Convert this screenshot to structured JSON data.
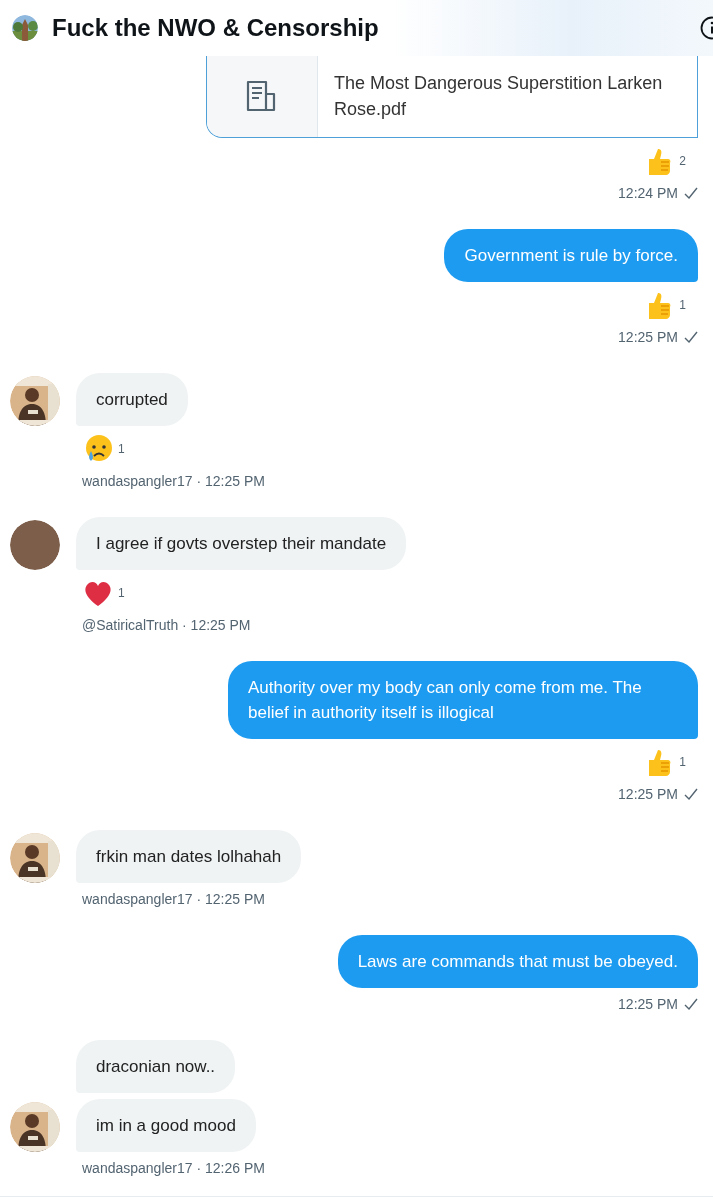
{
  "header": {
    "title": "Fuck the NWO & Censorship"
  },
  "messages": [
    {
      "kind": "attachment",
      "title": "The Most Dangerous Superstition Larken Rose.pdf",
      "reactions": [
        {
          "kind": "thumbs_up",
          "count": "2"
        }
      ],
      "time": "12:24 PM",
      "seen": true
    },
    {
      "kind": "sent",
      "bubbles": [
        "Government is rule by force."
      ],
      "reactions": [
        {
          "kind": "thumbs_up",
          "count": "1"
        }
      ],
      "time": "12:25 PM",
      "seen": true
    },
    {
      "kind": "received",
      "avatar": {
        "kind": "photo"
      },
      "bubbles": [
        "corrupted"
      ],
      "reactions": [
        {
          "kind": "crying_face",
          "count": "1"
        }
      ],
      "meta": "wandaspangler17 · 12:25 PM"
    },
    {
      "kind": "received",
      "avatar": {
        "kind": "plain"
      },
      "bubbles": [
        "I agree if govts overstep their mandate"
      ],
      "reactions": [
        {
          "kind": "heart",
          "count": "1"
        }
      ],
      "meta": "@SatiricalTruth · 12:25 PM"
    },
    {
      "kind": "sent",
      "bubbles": [
        "Authority over my body can only come from me. The belief in authority itself is illogical"
      ],
      "reactions": [
        {
          "kind": "thumbs_up",
          "count": "1"
        }
      ],
      "time": "12:25 PM",
      "seen": true
    },
    {
      "kind": "received",
      "avatar": {
        "kind": "photo"
      },
      "bubbles": [
        "frkin man dates lolhahah"
      ],
      "meta": "wandaspangler17 · 12:25 PM"
    },
    {
      "kind": "sent",
      "bubbles": [
        "Laws are commands that must be obeyed."
      ],
      "time": "12:25 PM",
      "seen": true
    },
    {
      "kind": "received",
      "avatar": {
        "kind": "photo"
      },
      "bubbles": [
        "draconian now..",
        "im in a good mood"
      ],
      "meta": "wandaspangler17 · 12:26 PM"
    }
  ]
}
